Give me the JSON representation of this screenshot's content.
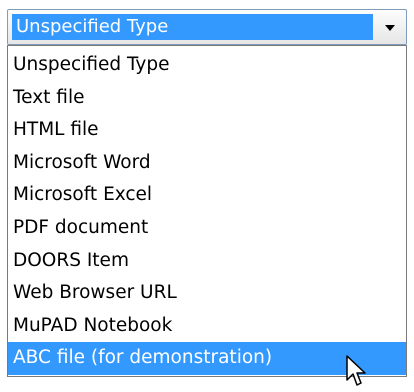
{
  "combo": {
    "selected_label": "Unspecified Type",
    "icon": "chevron-down-icon"
  },
  "options": [
    {
      "label": "Unspecified Type",
      "selected": false
    },
    {
      "label": "Text file",
      "selected": false
    },
    {
      "label": "HTML file",
      "selected": false
    },
    {
      "label": "Microsoft Word",
      "selected": false
    },
    {
      "label": "Microsoft Excel",
      "selected": false
    },
    {
      "label": "PDF document",
      "selected": false
    },
    {
      "label": "DOORS Item",
      "selected": false
    },
    {
      "label": "Web Browser URL",
      "selected": false
    },
    {
      "label": "MuPAD Notebook",
      "selected": false
    },
    {
      "label": "ABC  file (for demonstration)",
      "selected": true
    }
  ],
  "colors": {
    "highlight": "#3399ff",
    "border": "#7f9db9"
  },
  "cursor_icon": "arrow-cursor-icon"
}
